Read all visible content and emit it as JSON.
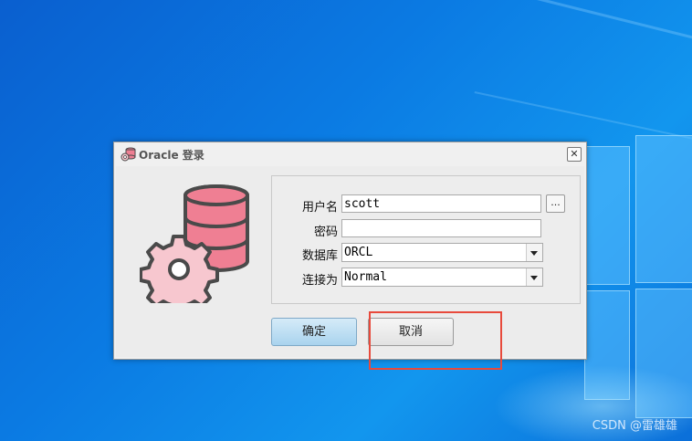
{
  "dialog": {
    "title": "Oracle 登录",
    "close_label": "✕"
  },
  "form": {
    "username": {
      "label": "用户名",
      "value": "scott",
      "browse_label": "..."
    },
    "password": {
      "label": "密码",
      "value": ""
    },
    "database": {
      "label": "数据库",
      "value": "ORCL"
    },
    "connect_as": {
      "label": "连接为",
      "value": "Normal"
    }
  },
  "buttons": {
    "ok_label": "确定",
    "cancel_label": "取消"
  },
  "watermark": "CSDN @雷雄雄",
  "colors": {
    "db_pink": "#ef7f93",
    "gear_pink": "#f7c7cf",
    "outline": "#4a4a4a",
    "highlight": "#e84a3c"
  }
}
